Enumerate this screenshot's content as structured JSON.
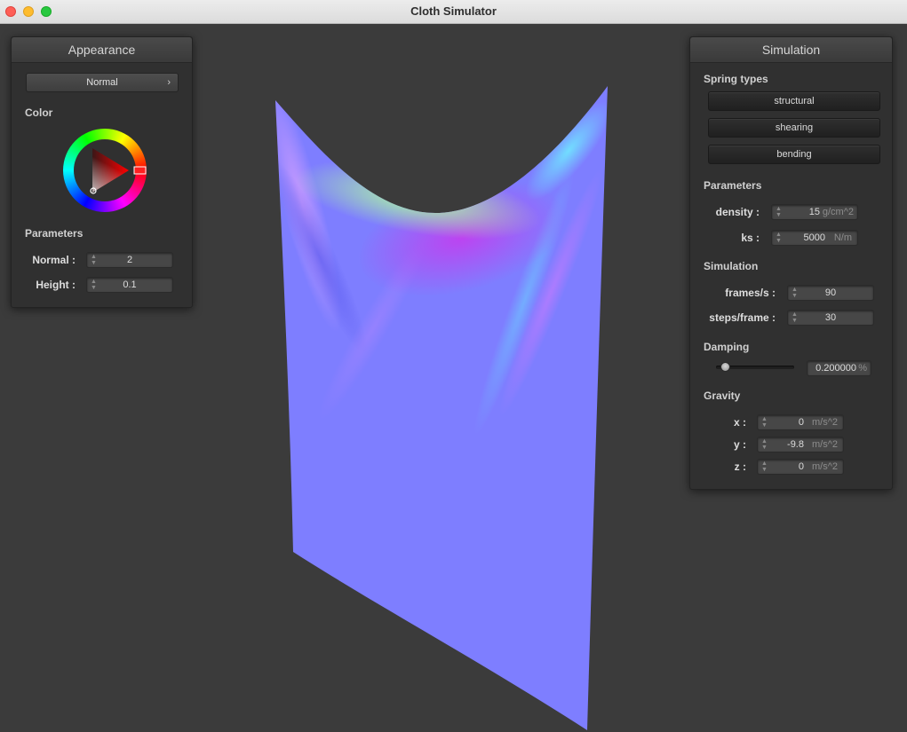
{
  "window": {
    "title": "Cloth Simulator"
  },
  "appearance": {
    "title": "Appearance",
    "shader_dropdown": "Normal",
    "color_label": "Color",
    "parameters_label": "Parameters",
    "normal_label": "Normal :",
    "normal_value": "2",
    "height_label": "Height :",
    "height_value": "0.1"
  },
  "simulation": {
    "title": "Simulation",
    "spring_types_label": "Spring types",
    "spring_buttons": [
      "structural",
      "shearing",
      "bending"
    ],
    "parameters_label": "Parameters",
    "density_label": "density :",
    "density_value": "15",
    "density_unit": "g/cm^2",
    "ks_label": "ks :",
    "ks_value": "5000",
    "ks_unit": "N/m",
    "sim_label": "Simulation",
    "fps_label": "frames/s :",
    "fps_value": "90",
    "steps_label": "steps/frame :",
    "steps_value": "30",
    "damping_label": "Damping",
    "damping_value": "0.200000",
    "damping_unit": "%",
    "damping_fraction": 0.2,
    "gravity_label": "Gravity",
    "gx_label": "x :",
    "gx_value": "0",
    "gy_label": "y :",
    "gy_value": "-9.8",
    "gz_label": "z :",
    "gz_value": "0",
    "g_unit": "m/s^2"
  },
  "colors": {
    "cloth_base": "#7e7eff",
    "background": "#3b3b3b",
    "panel": "#303030"
  }
}
